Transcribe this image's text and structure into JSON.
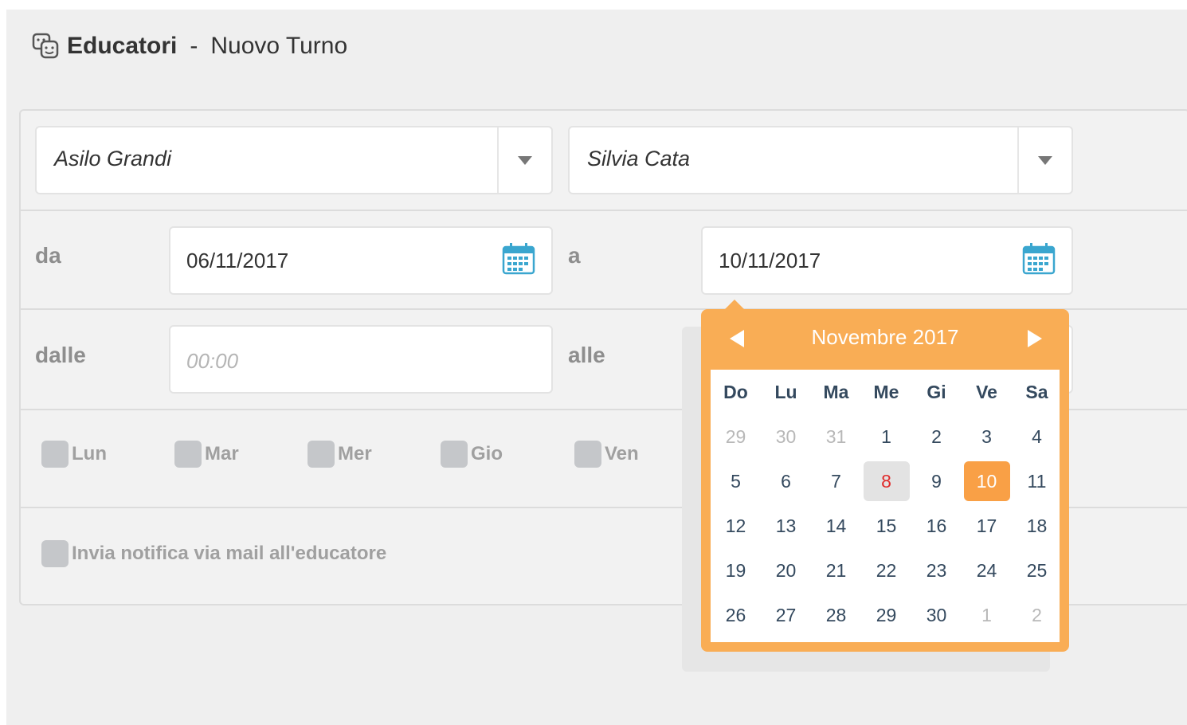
{
  "header": {
    "title_strong": "Educatori",
    "separator": "-",
    "title_rest": "Nuovo Turno",
    "icon": "theater-masks-icon"
  },
  "form": {
    "school_select": {
      "value": "Asilo Grandi"
    },
    "educator_select": {
      "value": "Silvia Cata"
    },
    "date_from": {
      "label": "da",
      "value": "06/11/2017",
      "icon": "calendar-icon"
    },
    "date_to": {
      "label": "a",
      "value": "10/11/2017",
      "icon": "calendar-icon"
    },
    "time_from": {
      "label": "dalle",
      "placeholder": "00:00"
    },
    "time_to": {
      "label": "alle"
    },
    "weekdays": [
      "Lun",
      "Mar",
      "Mer",
      "Gio",
      "Ven"
    ],
    "notify_label": "Invia notifica via mail all'educatore"
  },
  "datepicker": {
    "month_label": "Novembre 2017",
    "weekday_headers": [
      "Do",
      "Lu",
      "Ma",
      "Me",
      "Gi",
      "Ve",
      "Sa"
    ],
    "days": [
      {
        "n": "29",
        "other": true
      },
      {
        "n": "30",
        "other": true
      },
      {
        "n": "31",
        "other": true
      },
      {
        "n": "1"
      },
      {
        "n": "2"
      },
      {
        "n": "3"
      },
      {
        "n": "4"
      },
      {
        "n": "5"
      },
      {
        "n": "6"
      },
      {
        "n": "7"
      },
      {
        "n": "8",
        "today": true
      },
      {
        "n": "9"
      },
      {
        "n": "10",
        "selected": true
      },
      {
        "n": "11"
      },
      {
        "n": "12"
      },
      {
        "n": "13"
      },
      {
        "n": "14"
      },
      {
        "n": "15"
      },
      {
        "n": "16"
      },
      {
        "n": "17"
      },
      {
        "n": "18"
      },
      {
        "n": "19"
      },
      {
        "n": "20"
      },
      {
        "n": "21"
      },
      {
        "n": "22"
      },
      {
        "n": "23"
      },
      {
        "n": "24"
      },
      {
        "n": "25"
      },
      {
        "n": "26"
      },
      {
        "n": "27"
      },
      {
        "n": "28"
      },
      {
        "n": "29"
      },
      {
        "n": "30"
      },
      {
        "n": "1",
        "other": true
      },
      {
        "n": "2",
        "other": true
      }
    ],
    "colors": {
      "accent": "#f9ad55",
      "selected": "#f9a046",
      "today_text": "#e02a2a"
    }
  }
}
